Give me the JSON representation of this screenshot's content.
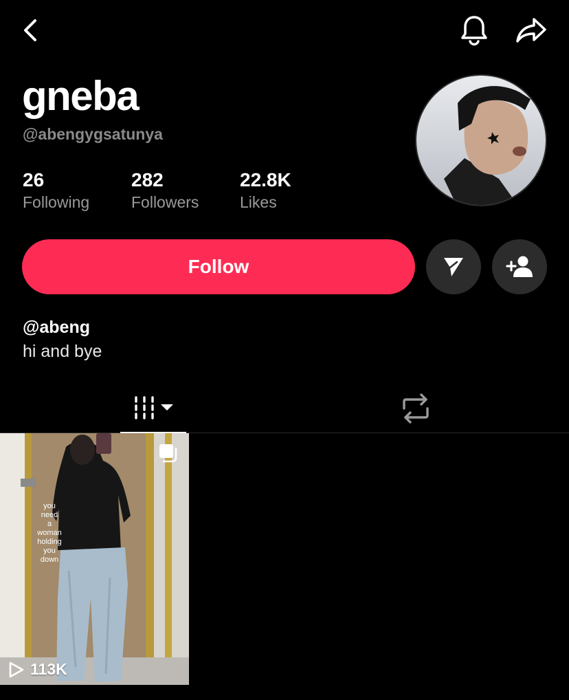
{
  "profile": {
    "display_name": "gneba",
    "username": "@abengygsatunya"
  },
  "stats": {
    "following": {
      "value": "26",
      "label": "Following"
    },
    "followers": {
      "value": "282",
      "label": "Followers"
    },
    "likes": {
      "value": "22.8K",
      "label": "Likes"
    }
  },
  "actions": {
    "follow_label": "Follow",
    "accent_color": "#fe2c55"
  },
  "bio": {
    "handle": "@abeng",
    "text": "hi and bye"
  },
  "icons": {
    "back": "chevron-left-icon",
    "notifications": "bell-icon",
    "share": "share-arrow-icon",
    "message": "send-icon",
    "add_friend": "add-user-icon",
    "videos_tab": "grid-icon",
    "reposts_tab": "repost-icon"
  },
  "videos": [
    {
      "caption": [
        "you",
        "need",
        "a",
        "woman",
        "holding",
        "you",
        "down"
      ],
      "views": "113K",
      "type": "photo-carousel"
    }
  ]
}
